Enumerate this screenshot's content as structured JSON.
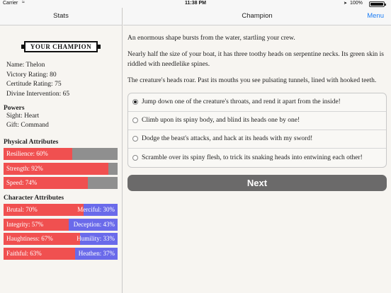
{
  "status_bar": {
    "carrier": "Carrier",
    "time": "11:38 PM",
    "battery": "100%",
    "wifi_icon": "wifi-icon",
    "location_icon": "location-arrow-icon",
    "battery_icon": "battery-icon"
  },
  "left_panel": {
    "title": "Stats",
    "logo_text": "YOUR CHAMPION",
    "info": {
      "name": "Name: Thelon",
      "victory": "Victory Rating: 80",
      "certitude": "Certitude Rating: 75",
      "divine": "Divine Intervention: 65"
    },
    "powers": {
      "title": "Powers",
      "items": [
        "Sight: Heart",
        "Gift: Command"
      ]
    },
    "physical": {
      "title": "Physical Attributes",
      "bars": [
        {
          "label": "Resilience: 60%",
          "value": 0.6
        },
        {
          "label": "Strength: 92%",
          "value": 0.92
        },
        {
          "label": "Speed: 74%",
          "value": 0.74
        }
      ]
    },
    "character": {
      "title": "Character Attributes",
      "bars": [
        {
          "left": "Brutal: 70%",
          "right": "Merciful: 30%",
          "value": 0.7
        },
        {
          "left": "Integrity: 57%",
          "right": "Deception: 43%",
          "value": 0.57
        },
        {
          "left": "Haughtiness: 67%",
          "right": "Humility: 33%",
          "value": 0.67
        },
        {
          "left": "Faithful: 63%",
          "right": "Heathen: 37%",
          "value": 0.63
        }
      ]
    },
    "colors": {
      "positive": "#f05050",
      "negative": "#6a6aea",
      "neutral": "#8f8f8f"
    }
  },
  "right_panel": {
    "title": "Champion",
    "menu_label": "Menu",
    "story": [
      "An enormous shape bursts from the water, startling your crew.",
      "Nearly half the size of your boat, it has three toothy heads on serpentine necks. Its green skin is riddled with needlelike spines.",
      "The creature's heads roar. Past its mouths you see pulsating tunnels, lined with hooked teeth."
    ],
    "choices": [
      {
        "label": "Jump down one of the creature's throats, and rend it apart from the inside!",
        "selected": true
      },
      {
        "label": "Climb upon its spiny body, and blind its heads one by one!",
        "selected": false
      },
      {
        "label": "Dodge the beast's attacks, and hack at its heads with my sword!",
        "selected": false
      },
      {
        "label": "Scramble over its spiny flesh, to trick its snaking heads into entwining each other!",
        "selected": false
      }
    ],
    "next_label": "Next"
  }
}
